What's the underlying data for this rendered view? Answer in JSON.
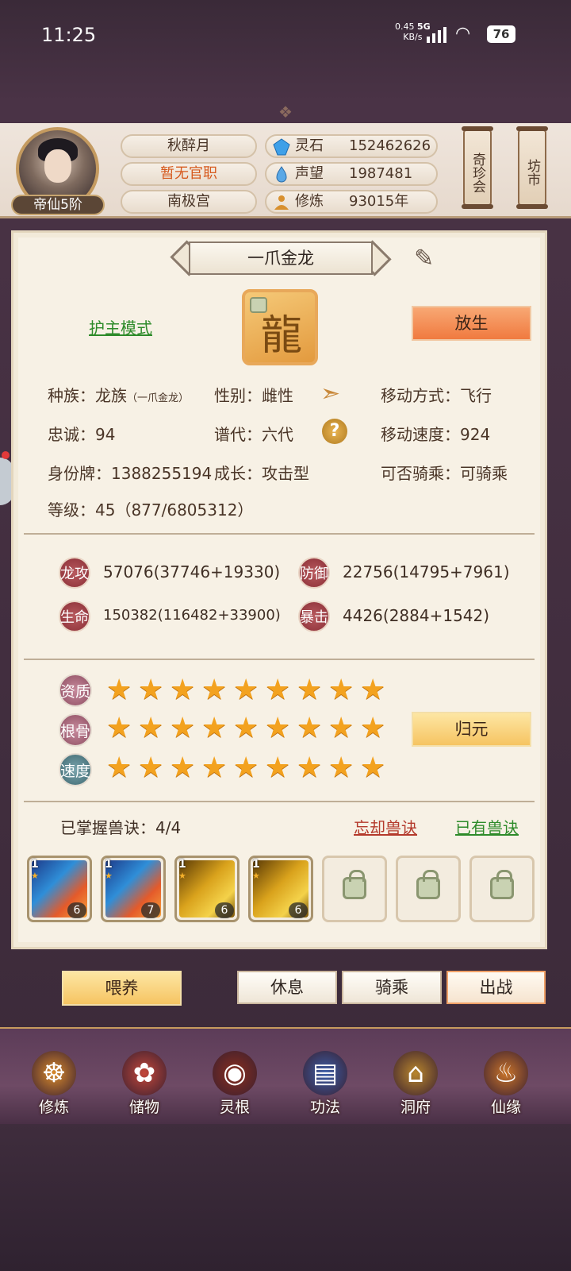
{
  "status_bar": {
    "time": "11:25",
    "net_speed": "0.45",
    "net_unit": "KB/s",
    "net_type": "5G",
    "battery": "76"
  },
  "player": {
    "name": "秋醉月",
    "official_rank": "暂无官职",
    "sect": "南极宫",
    "realm": "帝仙5阶",
    "resources": [
      {
        "label": "灵石",
        "value": "152462626",
        "icon": "spirit-stone-icon"
      },
      {
        "label": "声望",
        "value": "1987481",
        "icon": "reputation-icon"
      },
      {
        "label": "修炼",
        "value": "93015年",
        "icon": "cultivation-icon"
      }
    ],
    "side_buttons": [
      "奇珍会",
      "坊市"
    ]
  },
  "pet": {
    "name": "一爪金龙",
    "guard_mode": "护主模式",
    "release_button": "放生",
    "info": [
      {
        "text": "种族：龙族",
        "sub": "（一爪金龙）"
      },
      {
        "text": "性别：雌性"
      },
      {
        "text": "移动方式：飞行"
      },
      {
        "text": "忠诚：94"
      },
      {
        "text": "谱代：六代"
      },
      {
        "text": "移动速度：924"
      },
      {
        "text": "身份牌：1388255194"
      },
      {
        "text": "成长：攻击型"
      },
      {
        "text": "可否骑乘：可骑乘"
      },
      {
        "text": "等级：45（877/6805312）"
      }
    ],
    "stats": [
      {
        "label": "龙攻",
        "value": "57076(37746+19330)"
      },
      {
        "label": "防御",
        "value": "22756(14795+7961)"
      },
      {
        "label": "生命",
        "value": "150382(116482+33900)"
      },
      {
        "label": "暴击",
        "value": "4426(2884+1542)"
      }
    ],
    "grades": [
      {
        "label": "资质",
        "stars": 9
      },
      {
        "label": "根骨",
        "stars": 9
      },
      {
        "label": "速度",
        "stars": 9
      }
    ],
    "reset_button": "归元",
    "skills_mastered": "已掌握兽诀：4/4",
    "forget_skill": "忘却兽诀",
    "owned_skills": "已有兽诀",
    "skills": [
      {
        "level": "1",
        "count": "6",
        "art": "blue"
      },
      {
        "level": "1",
        "count": "7",
        "art": "blue"
      },
      {
        "level": "1",
        "count": "6",
        "art": "gold"
      },
      {
        "level": "1",
        "count": "6",
        "art": "gold"
      }
    ],
    "locked_slots": 3
  },
  "actions": {
    "feed": "喂养",
    "rest": "休息",
    "ride": "骑乘",
    "battle": "出战"
  },
  "nav": [
    {
      "label": "修炼",
      "icon": "cultivation-nav-icon",
      "color": "#d98a2b"
    },
    {
      "label": "储物",
      "icon": "storage-bag-icon",
      "color": "#c3473a"
    },
    {
      "label": "灵根",
      "icon": "spirit-root-icon",
      "color": "#8a2e1e"
    },
    {
      "label": "功法",
      "icon": "technique-book-icon",
      "color": "#3b5ea8"
    },
    {
      "label": "洞府",
      "icon": "cave-mansion-icon",
      "color": "#b8862c"
    },
    {
      "label": "仙缘",
      "icon": "gourd-icon",
      "color": "#c9742a"
    }
  ]
}
